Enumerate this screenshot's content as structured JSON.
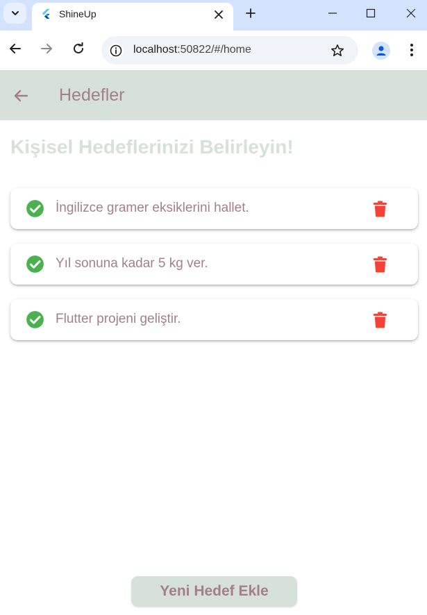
{
  "browser": {
    "tab_title": "ShineUp",
    "url_host": "localhost",
    "url_rest": ":50822/#/home",
    "icons": {
      "tab_search": "chevron-down-icon",
      "favicon": "flutter-icon",
      "close": "close-icon",
      "new_tab": "plus-icon",
      "back": "arrow-left-icon",
      "forward": "arrow-right-icon",
      "reload": "reload-icon",
      "info": "info-icon",
      "bookmark": "star-icon",
      "profile": "person-icon",
      "menu": "more-vertical-icon"
    }
  },
  "appbar": {
    "title": "Hedefler",
    "back_icon": "arrow-left-icon"
  },
  "heading": "Kişisel Hedeflerinizi Belirleyin!",
  "goals": [
    {
      "text": "İngilizce gramer eksiklerini hallet.",
      "completed": true
    },
    {
      "text": "Yıl sonuna kadar 5 kg ver.",
      "completed": true
    },
    {
      "text": "Flutter projeni geliştir.",
      "completed": true
    }
  ],
  "add_button_label": "Yeni Hedef Ekle",
  "colors": {
    "appbar_bg": "#d6e1da",
    "text_mauve": "#a37f89",
    "check_green": "#4caf50",
    "delete_red": "#f44336",
    "tabbar_bg": "#d3e3fd"
  }
}
